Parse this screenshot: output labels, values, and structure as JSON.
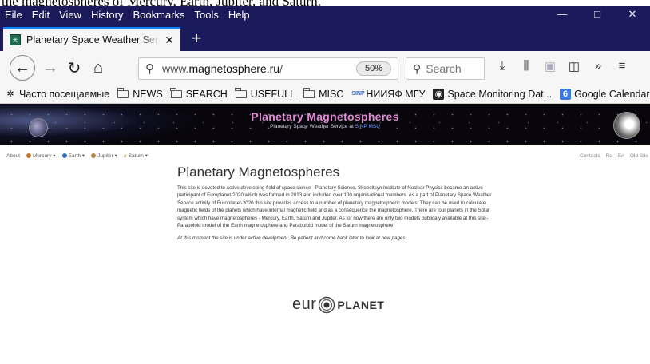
{
  "caption": "the magnetospheres of Mercury, Earth, Jupiter, and Saturn.",
  "menu": [
    "Eile",
    "Edit",
    "View",
    "History",
    "Bookmarks",
    "Tools",
    "Help"
  ],
  "window_controls": {
    "minimize": "—",
    "maximize": "□",
    "close": "✕"
  },
  "tab": {
    "title": "Planetary Space Weather Servic",
    "close": "✕"
  },
  "new_tab": "+",
  "url": {
    "prefix": "www.",
    "domain": "magnetosphere.ru",
    "suffix": "/",
    "zoom": "50%"
  },
  "search": {
    "placeholder": "Search"
  },
  "bookmarks": [
    {
      "label": "Часто посещаемые",
      "icon": "gear-icon"
    },
    {
      "label": "NEWS",
      "icon": "folder-icon"
    },
    {
      "label": "SEARCH",
      "icon": "folder-icon"
    },
    {
      "label": "USEFULL",
      "icon": "folder-icon"
    },
    {
      "label": "MISC",
      "icon": "folder-icon"
    },
    {
      "label": "НИИЯФ МГУ",
      "icon": "sinp-icon"
    },
    {
      "label": "Space Monitoring Dat...",
      "icon": "satellite-icon"
    },
    {
      "label": "Google Calendar",
      "icon": "calendar-icon"
    }
  ],
  "banner": {
    "title": "Planetary Magnetospheres",
    "subtitle": "Planetary Space Weather Service at",
    "subtitle_link": "SINP MSU"
  },
  "sitenav": {
    "items": [
      "About",
      "Mercury ▾",
      "Earth ▾",
      "Jupiter ▾",
      "Saturn ▾"
    ],
    "right": [
      "Contacts",
      "Ru",
      "En",
      "Old Site"
    ]
  },
  "content": {
    "heading": "Planetary Magnetospheres",
    "paragraph": "This site is devoted to active developing field of space sience - Planetary Science. Skobeltsyn Institute of Nuclear Physics became an active participant of Europlanet-2020 which was formed in 2013 and included over 100 organisational members. As a part of Planetary Space Weather Service activity of Europlanet-2020 this site provides access to a number of planetary magnetospheric models. They can be used to calculate magnetic fields of the planets which have internal magnetic field and as a consequence the magnetosphere. There are four planets in the Solar system which have magnetospheres - Mercury, Earth, Saturn and Jupiter. As for now there are only two models publicaly available at this site - Paraboloid model of the Earth magnetosphere and Paraboloid model of the Saturn magnetosphere.",
    "note": "At this moment the site is under active develpment. Be patient and come back later to look at new pages."
  },
  "logo": {
    "left": "eur",
    "right": "PLANET"
  },
  "colors": {
    "titlebar": "#1b1a5a",
    "accent": "#0a84ff",
    "banner_title": "#e08bd6"
  }
}
